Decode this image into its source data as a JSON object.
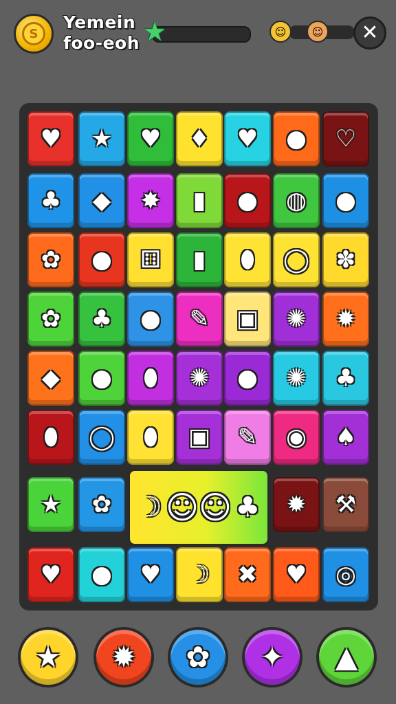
{
  "header": {
    "coin_icon": "coin-icon",
    "coin_symbol": "S",
    "title_line1": "Yemein",
    "title_line2": "foo-eoh",
    "progress_icon": "star-icon",
    "progress_fraction": 0.0,
    "opponents": [
      {
        "icon": "avatar-girl-icon",
        "glyph": "☺"
      },
      {
        "icon": "avatar-boy-icon",
        "glyph": "☺"
      }
    ],
    "opponent_progress_fraction": 0.0,
    "close_glyph": "✕"
  },
  "board": {
    "rows": [
      [
        {
          "icon": "heart-icon",
          "glyph": "♥",
          "color": "#e8312b"
        },
        {
          "icon": "star-icon",
          "glyph": "★",
          "color": "#25a8e6"
        },
        {
          "icon": "heart-lollipop-icon",
          "glyph": "♥",
          "color": "#2fbd3a"
        },
        {
          "icon": "bell-icon",
          "glyph": "♦",
          "color": "#ffe22d"
        },
        {
          "icon": "heart-icon",
          "glyph": "♥",
          "color": "#27d3e3"
        },
        {
          "icon": "lollipop-icon",
          "glyph": "●",
          "color": "#ff6a1a"
        },
        {
          "icon": "heart-ring-icon",
          "glyph": "♡",
          "color": "#7a1414"
        }
      ],
      [
        {
          "icon": "leaf-icon",
          "glyph": "♣",
          "color": "#1f93e8"
        },
        {
          "icon": "candy-icon",
          "glyph": "◆",
          "color": "#2190e6"
        },
        {
          "icon": "burst-icon",
          "glyph": "✸",
          "color": "#c52fe6"
        },
        {
          "icon": "book-icon",
          "glyph": "▮",
          "color": "#7fd938"
        },
        {
          "icon": "cherry-icon",
          "glyph": "●",
          "color": "#b8161b"
        },
        {
          "icon": "popsicle-icon",
          "glyph": "◍",
          "color": "#40c63f"
        },
        {
          "icon": "balloon-icon",
          "glyph": "●",
          "color": "#1e90e4"
        }
      ],
      [
        {
          "icon": "gear-icon",
          "glyph": "✿",
          "color": "#ff6b1c"
        },
        {
          "icon": "cherry-icon",
          "glyph": "●",
          "color": "#e8351f"
        },
        {
          "icon": "dice-icon",
          "glyph": "⚅",
          "color": "#ffe030"
        },
        {
          "icon": "book-icon",
          "glyph": "▮",
          "color": "#2db53a"
        },
        {
          "icon": "pill-icon",
          "glyph": "⬮",
          "color": "#ffe334"
        },
        {
          "icon": "ring-icon",
          "glyph": "◯",
          "color": "#ffe334"
        },
        {
          "icon": "bow-icon",
          "glyph": "✽",
          "color": "#ffd92c"
        }
      ],
      [
        {
          "icon": "gear-icon",
          "glyph": "✿",
          "color": "#4fd33a"
        },
        {
          "icon": "leaf-icon",
          "glyph": "♣",
          "color": "#36c13e"
        },
        {
          "icon": "smiley-ball-icon",
          "glyph": "●",
          "color": "#2e93e6"
        },
        {
          "icon": "pencil-icon",
          "glyph": "✎",
          "color": "#ec2fc1"
        },
        {
          "icon": "block-face-icon",
          "glyph": "▣",
          "color": "#ffe57a"
        },
        {
          "icon": "gear-icon",
          "glyph": "✺",
          "color": "#a02fd8"
        },
        {
          "icon": "burst-icon",
          "glyph": "✹",
          "color": "#ff6f1c"
        }
      ],
      [
        {
          "icon": "popsicle-icon",
          "glyph": "◆",
          "color": "#ff721c"
        },
        {
          "icon": "orange-ball-icon",
          "glyph": "●",
          "color": "#4fd33a"
        },
        {
          "icon": "candy-bar-icon",
          "glyph": "⬮",
          "color": "#c12fe0"
        },
        {
          "icon": "gear-icon",
          "glyph": "✺",
          "color": "#a530d8"
        },
        {
          "icon": "bomb-icon",
          "glyph": "●",
          "color": "#9a2ad6"
        },
        {
          "icon": "gear-icon",
          "glyph": "✺",
          "color": "#27c9e3"
        },
        {
          "icon": "leaf-icon",
          "glyph": "♣",
          "color": "#29c8e0"
        }
      ],
      [
        {
          "icon": "candy-wrap-icon",
          "glyph": "⬮",
          "color": "#b8161b"
        },
        {
          "icon": "ring-icon",
          "glyph": "◯",
          "color": "#2190e6"
        },
        {
          "icon": "pill-icon",
          "glyph": "⬮",
          "color": "#ffe234"
        },
        {
          "icon": "block-face-icon",
          "glyph": "▣",
          "color": "#a630d8"
        },
        {
          "icon": "crayon-icon",
          "glyph": "✎",
          "color": "#f07de6"
        },
        {
          "icon": "monster-icon",
          "glyph": "◉",
          "color": "#ee2a82"
        },
        {
          "icon": "tree-icon",
          "glyph": "♠",
          "color": "#a32fd7"
        }
      ],
      [
        {
          "icon": "star-icon",
          "glyph": "★",
          "color": "#4bd33a"
        },
        {
          "icon": "flower-icon",
          "glyph": "✿",
          "color": "#2396e6"
        },
        null,
        null,
        null,
        {
          "icon": "burst-icon",
          "glyph": "✹",
          "color": "#7a1414"
        },
        {
          "icon": "hammer-icon",
          "glyph": "⚒",
          "color": "#8a4b3b"
        }
      ],
      [
        {
          "icon": "heart-icon",
          "glyph": "♥",
          "color": "#e0251f"
        },
        {
          "icon": "orange-ball-icon",
          "glyph": "●",
          "color": "#22d2d8"
        },
        {
          "icon": "heart-icon",
          "glyph": "♥",
          "color": "#1f90e4"
        },
        {
          "icon": "banana-icon",
          "glyph": "☽",
          "color": "#ffe22d"
        },
        {
          "icon": "cross-icon",
          "glyph": "✖",
          "color": "#ff6a1c"
        },
        {
          "icon": "heart-icon",
          "glyph": "♥",
          "color": "#ff5a1a"
        },
        {
          "icon": "shell-icon",
          "glyph": "◎",
          "color": "#1f90e4"
        }
      ]
    ],
    "special_tile": {
      "icons": [
        "banana-icon",
        "characters-icon",
        "leaf-icon"
      ],
      "glyphs": [
        "☽",
        "☺☺",
        "♣"
      ]
    }
  },
  "boosters": [
    {
      "icon": "star-booster-icon",
      "glyph": "★",
      "color": "#ffd52c"
    },
    {
      "icon": "gear-booster-icon",
      "glyph": "✹",
      "color": "#f0451e"
    },
    {
      "icon": "flower-booster-icon",
      "glyph": "✿",
      "color": "#2590e6"
    },
    {
      "icon": "sparkle-booster-icon",
      "glyph": "✦",
      "color": "#b030e6"
    },
    {
      "icon": "triangle-booster-icon",
      "glyph": "▲",
      "color": "#5ed63a"
    }
  ]
}
